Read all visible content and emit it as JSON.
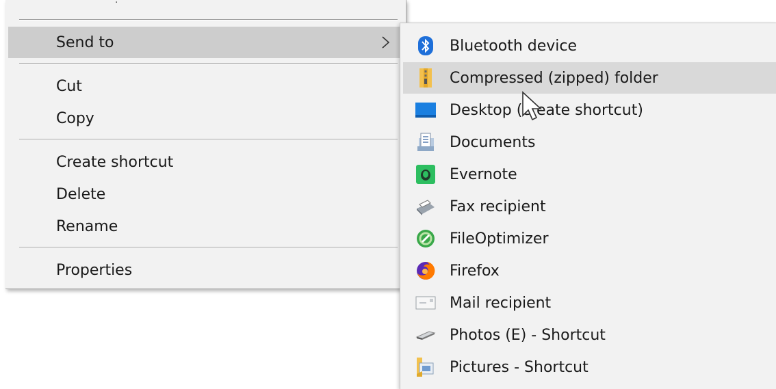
{
  "context_menu": {
    "items": [
      {
        "label": "Send to",
        "has_submenu": true,
        "active": true
      },
      {
        "label": "Cut"
      },
      {
        "label": "Copy"
      },
      {
        "label": "Create shortcut"
      },
      {
        "label": "Delete"
      },
      {
        "label": "Rename"
      },
      {
        "label": "Properties"
      }
    ]
  },
  "send_to_menu": {
    "items": [
      {
        "label": "Bluetooth device",
        "icon": "bluetooth-icon"
      },
      {
        "label": "Compressed (zipped) folder",
        "icon": "zip-folder-icon",
        "hovered": true
      },
      {
        "label": "Desktop (create shortcut)",
        "icon": "desktop-icon"
      },
      {
        "label": "Documents",
        "icon": "documents-icon"
      },
      {
        "label": "Evernote",
        "icon": "evernote-icon"
      },
      {
        "label": "Fax recipient",
        "icon": "fax-icon"
      },
      {
        "label": "FileOptimizer",
        "icon": "fileoptimizer-icon"
      },
      {
        "label": "Firefox",
        "icon": "firefox-icon"
      },
      {
        "label": "Mail recipient",
        "icon": "mail-icon"
      },
      {
        "label": "Photos (E) - Shortcut",
        "icon": "drive-icon"
      },
      {
        "label": "Pictures - Shortcut",
        "icon": "pictures-folder-icon"
      }
    ]
  },
  "colors": {
    "menu_bg": "#f2f2f2",
    "active_bg": "#cdcdcd",
    "hover_bg": "#d9d9d9",
    "bluetooth_blue": "#1e6fd9",
    "evernote_green": "#2dbe60",
    "firefox_orange": "#ff7a00"
  }
}
